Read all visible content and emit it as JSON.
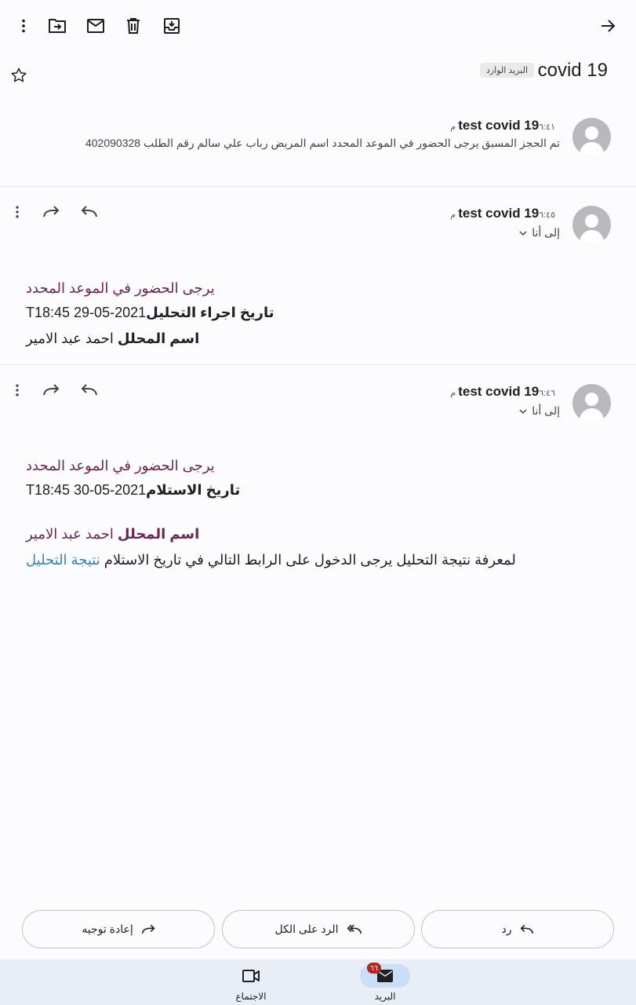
{
  "toolbar": {
    "icons": [
      "more-vert-icon",
      "move-to-icon",
      "mark-unread-icon",
      "delete-icon",
      "archive-icon",
      "back-arrow-icon"
    ]
  },
  "subject": {
    "title": "covid 19",
    "label": "البريد الوارد",
    "star_icon": "star-outline-icon"
  },
  "messages": [
    {
      "sender": "test covid  19",
      "time": "٦:٤١ م",
      "snippet": "تم الحجز المسبق يرجى الحضور في الموعد المحدد اسم المريض رباب علي سالم رقم الطلب 402090328"
    },
    {
      "sender": "test covid  19",
      "time": "٦:٤٥ م",
      "to": "إلى أنا",
      "line1": "يرجى الحضور في الموعد المحدد",
      "line2_bold": "تاريخ اجراء التحليل",
      "line2_value": "T18:45 29-05-2021",
      "line3_bold": "اسم المحلل",
      "line3_value": "احمد عبد الامير"
    },
    {
      "sender": "test covid  19",
      "time": "٦:٤٦ م",
      "to": "إلى أنا",
      "line1": "يرجى الحضور في الموعد المحدد",
      "line2_bold": "تاريخ الاستلام",
      "line2_value": "T18:45 30-05-2021",
      "line3_bold": "اسم المحلل",
      "line3_value": "احمد عبد الامير",
      "line4_text": "لمعرفة نتيجة التحليل يرجى الدخول على الرابط التالي في تاريخ الاستلام",
      "line4_link": "نتيجة التحليل"
    }
  ],
  "actions": {
    "reply": "رد",
    "reply_all": "الرد على الكل",
    "forward": "إعادة توجيه"
  },
  "bottom_nav": {
    "mail": "البريد",
    "mail_badge": "٦٦",
    "meet": "الاجتماع"
  },
  "colors": {
    "accent_purple": "#6a2456",
    "link": "#3d7fb5",
    "nav_bg": "#e9eef6",
    "nav_active": "#c9def7",
    "badge": "#b3261e"
  }
}
